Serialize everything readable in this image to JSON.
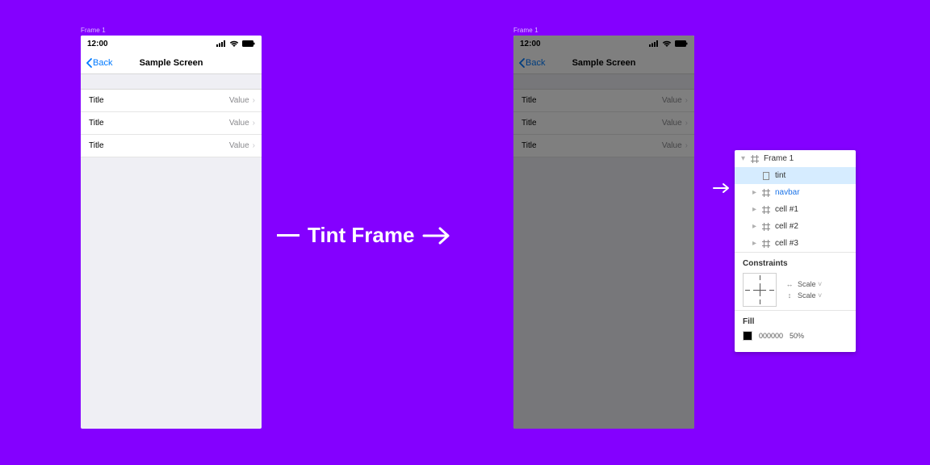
{
  "frame_label_left": "Frame 1",
  "frame_label_right": "Frame 1",
  "statusbar": {
    "time": "12:00"
  },
  "navbar": {
    "back": "Back",
    "title": "Sample Screen"
  },
  "cells": [
    {
      "title": "Title",
      "value": "Value"
    },
    {
      "title": "Title",
      "value": "Value"
    },
    {
      "title": "Title",
      "value": "Value"
    }
  ],
  "caption": "Tint Frame",
  "layers": {
    "root": "Frame 1",
    "tint": "tint",
    "navbar": "navbar",
    "cell1": "cell #1",
    "cell2": "cell #2",
    "cell3": "cell #3"
  },
  "constraints": {
    "heading": "Constraints",
    "h": "Scale",
    "v": "Scale"
  },
  "fill": {
    "heading": "Fill",
    "hex": "000000",
    "opacity": "50%"
  }
}
